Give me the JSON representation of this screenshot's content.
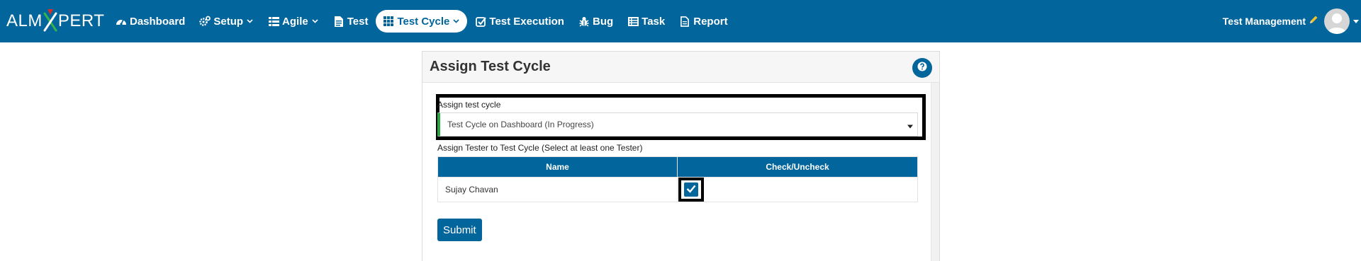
{
  "brand": {
    "prefix": "ALM",
    "suffix": "PERT"
  },
  "nav": {
    "items": [
      {
        "label": "Dashboard",
        "icon": "dashboard-icon"
      },
      {
        "label": "Setup",
        "icon": "cogs-icon",
        "dropdown": true
      },
      {
        "label": "Agile",
        "icon": "list-icon",
        "dropdown": true
      },
      {
        "label": "Test",
        "icon": "file-icon"
      },
      {
        "label": "Test Cycle",
        "icon": "grid-icon",
        "dropdown": true,
        "active": true
      },
      {
        "label": "Test Execution",
        "icon": "check-square-icon"
      },
      {
        "label": "Bug",
        "icon": "bug-icon"
      },
      {
        "label": "Task",
        "icon": "tasks-icon"
      },
      {
        "label": "Report",
        "icon": "report-icon"
      }
    ],
    "user_label": "Test Management"
  },
  "panel": {
    "title": "Assign Test Cycle",
    "cycle_label": "Assign test cycle",
    "cycle_value": "Test Cycle on Dashboard (In Progress)",
    "tester_label": "Assign Tester to Test Cycle (Select at least one Tester)",
    "table": {
      "headers": [
        "Name",
        "Check/Uncheck"
      ],
      "rows": [
        {
          "name": "Sujay Chavan",
          "checked": true
        }
      ]
    },
    "submit_label": "Submit"
  },
  "colors": {
    "primary": "#02659b",
    "accent_green": "#28a745",
    "brand_x": "#34b44a"
  }
}
